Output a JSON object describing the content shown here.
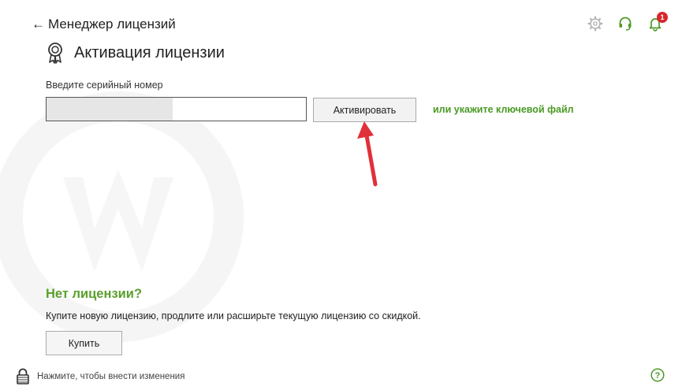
{
  "header": {
    "back_label": "Менеджер лицензий",
    "icons": [
      "gear-icon",
      "headset-icon",
      "bell-icon"
    ],
    "notification_count": "1"
  },
  "page": {
    "title": "Активация лицензии",
    "title_icon": "license-badge-icon"
  },
  "activation": {
    "serial_label": "Введите серийный номер",
    "serial_value": "",
    "activate_label": "Активировать",
    "key_file_link": "или укажите ключевой файл"
  },
  "no_license": {
    "title": "Нет лицензии?",
    "text": "Купите новую лицензию, продлите или расширьте текущую лицензию со скидкой.",
    "buy_label": "Купить"
  },
  "footer": {
    "lock_text": "Нажмите, чтобы внести изменения",
    "lock_icon": "lock-icon",
    "help_icon": "help-icon"
  },
  "colors": {
    "accent_green": "#5aa02c",
    "link_green": "#4a9a25",
    "badge_red": "#d9262c",
    "annotation_red": "#e0313a"
  }
}
